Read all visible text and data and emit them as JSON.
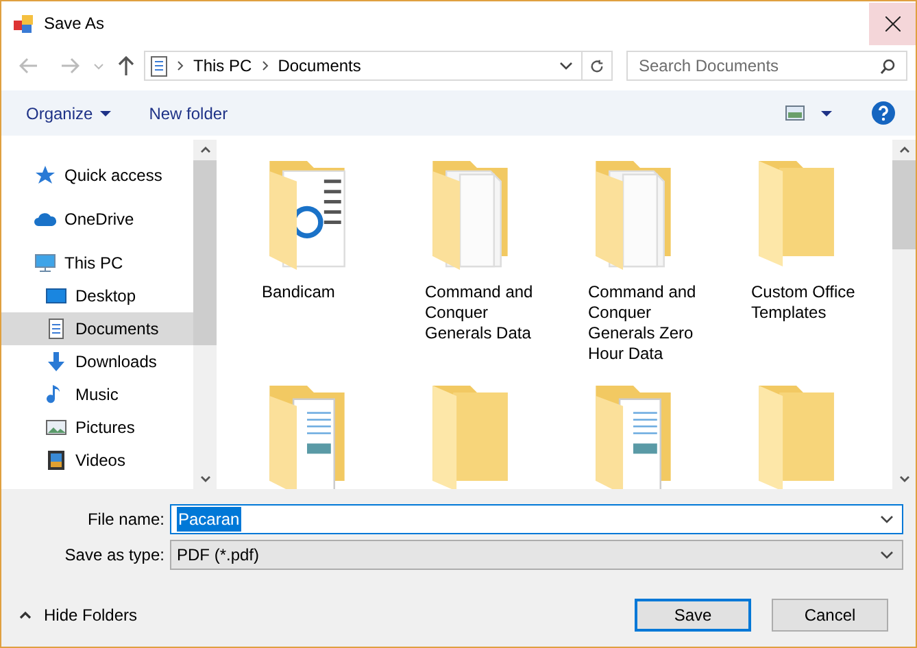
{
  "window": {
    "title": "Save As"
  },
  "address": {
    "crumbs": [
      "This PC",
      "Documents"
    ]
  },
  "search": {
    "placeholder": "Search Documents"
  },
  "toolbar": {
    "organize": "Organize",
    "new_folder": "New folder"
  },
  "sidebar": {
    "items": [
      {
        "label": "Quick access",
        "kind": "star",
        "selected": false
      },
      {
        "label": "OneDrive",
        "kind": "cloud",
        "selected": false
      },
      {
        "label": "This PC",
        "kind": "pc",
        "selected": false,
        "children": [
          {
            "label": "Desktop",
            "kind": "desktop",
            "selected": false
          },
          {
            "label": "Documents",
            "kind": "documents",
            "selected": true
          },
          {
            "label": "Downloads",
            "kind": "downloads",
            "selected": false
          },
          {
            "label": "Music",
            "kind": "music",
            "selected": false
          },
          {
            "label": "Pictures",
            "kind": "pictures",
            "selected": false
          },
          {
            "label": "Videos",
            "kind": "videos",
            "selected": false
          }
        ]
      }
    ]
  },
  "folders": [
    {
      "name": "Bandicam",
      "kind": "app"
    },
    {
      "name": "Command and Conquer Generals Data",
      "kind": "pages"
    },
    {
      "name": "Command and Conquer Generals Zero Hour Data",
      "kind": "pages"
    },
    {
      "name": "Custom Office Templates",
      "kind": "plain"
    },
    {
      "kind": "docs"
    },
    {
      "kind": "plain"
    },
    {
      "kind": "docs"
    },
    {
      "kind": "plain"
    }
  ],
  "file_name": {
    "label": "File name:",
    "value": "Pacaran"
  },
  "save_type": {
    "label": "Save as type:",
    "value": "PDF (*.pdf)"
  },
  "hide_folders": "Hide Folders",
  "buttons": [
    {
      "label": "Save",
      "default": true
    },
    {
      "label": "Cancel",
      "default": false
    }
  ]
}
